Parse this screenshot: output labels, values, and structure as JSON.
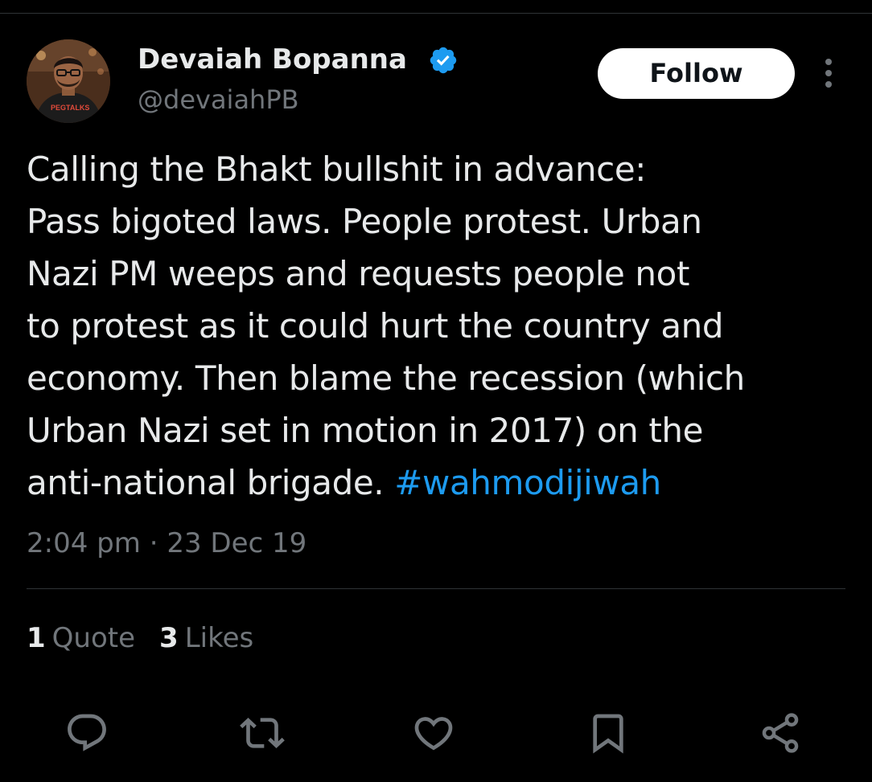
{
  "tweet": {
    "author": {
      "display_name": "Devaiah Bopanna",
      "handle": "@devaiahPB",
      "verified": true,
      "avatar_shirt_text": "PEGTALKS"
    },
    "follow_label": "Follow",
    "text_lines": [
      "Calling the Bhakt bullshit in advance:",
      "Pass bigoted laws. People protest. Urban",
      "Nazi PM weeps and requests people not",
      "to protest as it could hurt the country and",
      "economy. Then blame the recession (which",
      "Urban Nazi set in motion in 2017) on the",
      "anti-national brigade."
    ],
    "hashtag": "#wahmodijiwah",
    "time": "2:04 pm",
    "separator": "·",
    "date": "23 Dec 19",
    "stats": {
      "quotes_count": "1",
      "quotes_label": "Quote",
      "likes_count": "3",
      "likes_label": "Likes"
    },
    "actions": [
      "reply-icon",
      "retweet-icon",
      "like-icon",
      "bookmark-icon",
      "share-icon"
    ]
  },
  "colors": {
    "background": "#000000",
    "text_primary": "#e7e9ea",
    "text_secondary": "#71767b",
    "accent": "#1d9bf0",
    "divider": "#2f3336",
    "follow_bg": "#ffffff"
  }
}
